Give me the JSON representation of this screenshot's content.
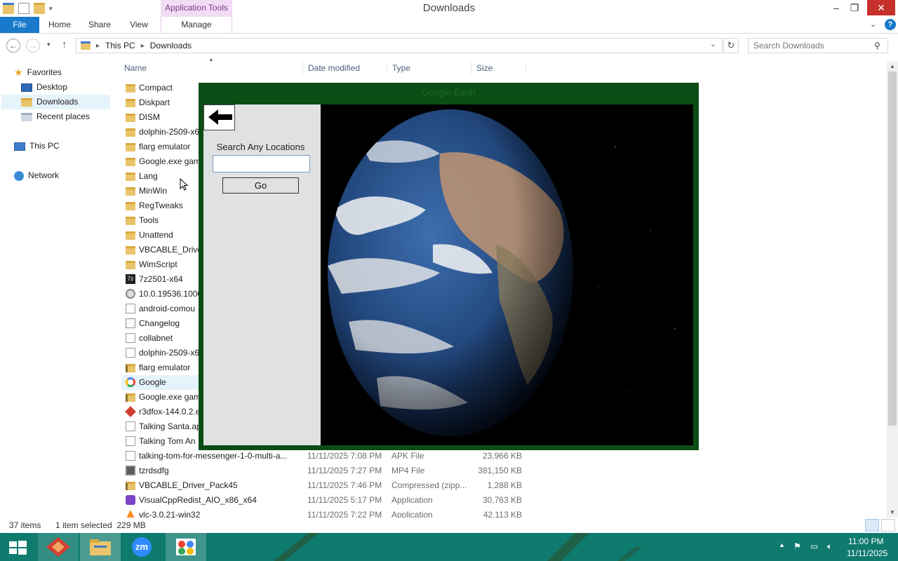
{
  "window": {
    "title": "Downloads",
    "context_tab": "Application Tools"
  },
  "ribbon": {
    "tabs": [
      "File",
      "Home",
      "Share",
      "View",
      "Manage"
    ]
  },
  "address": {
    "crumbs": [
      "This PC",
      "Downloads"
    ],
    "search_placeholder": "Search Downloads"
  },
  "nav": {
    "favorites": "Favorites",
    "desktop": "Desktop",
    "downloads": "Downloads",
    "recent": "Recent places",
    "this_pc": "This PC",
    "network": "Network"
  },
  "columns": [
    "Name",
    "Date modified",
    "Type",
    "Size"
  ],
  "files": [
    {
      "name": "Compact",
      "icon": "folder",
      "date": "",
      "type": "",
      "size": ""
    },
    {
      "name": "Diskpart",
      "icon": "folder",
      "date": "",
      "type": "",
      "size": ""
    },
    {
      "name": "DISM",
      "icon": "folder",
      "date": "",
      "type": "",
      "size": ""
    },
    {
      "name": "dolphin-2509-x6",
      "icon": "folder",
      "date": "",
      "type": "",
      "size": ""
    },
    {
      "name": "flarg emulator",
      "icon": "folder",
      "date": "",
      "type": "",
      "size": ""
    },
    {
      "name": "Google.exe gam",
      "icon": "folder",
      "date": "",
      "type": "",
      "size": ""
    },
    {
      "name": "Lang",
      "icon": "folder",
      "date": "",
      "type": "",
      "size": ""
    },
    {
      "name": "MinWin",
      "icon": "folder",
      "date": "",
      "type": "",
      "size": ""
    },
    {
      "name": "RegTweaks",
      "icon": "folder",
      "date": "",
      "type": "",
      "size": ""
    },
    {
      "name": "Tools",
      "icon": "folder",
      "date": "",
      "type": "",
      "size": ""
    },
    {
      "name": "Unattend",
      "icon": "folder",
      "date": "",
      "type": "",
      "size": ""
    },
    {
      "name": "VBCABLE_Driver",
      "icon": "folder",
      "date": "",
      "type": "",
      "size": ""
    },
    {
      "name": "WimScript",
      "icon": "folder",
      "date": "",
      "type": "",
      "size": ""
    },
    {
      "name": "7z2501-x64",
      "icon": "7z",
      "date": "",
      "type": "",
      "size": ""
    },
    {
      "name": "10.0.19536.1000.",
      "icon": "gear",
      "date": "",
      "type": "",
      "size": ""
    },
    {
      "name": "android-comou",
      "icon": "doc",
      "date": "",
      "type": "",
      "size": ""
    },
    {
      "name": "Changelog",
      "icon": "txt",
      "date": "",
      "type": "",
      "size": ""
    },
    {
      "name": "collabnet",
      "icon": "doc",
      "date": "",
      "type": "",
      "size": ""
    },
    {
      "name": "dolphin-2509-x6",
      "icon": "doc",
      "date": "",
      "type": "",
      "size": ""
    },
    {
      "name": "flarg emulator",
      "icon": "zip",
      "date": "",
      "type": "",
      "size": ""
    },
    {
      "name": "Google",
      "icon": "google",
      "date": "",
      "type": "",
      "size": ""
    },
    {
      "name": "Google.exe gam",
      "icon": "zip",
      "date": "",
      "type": "",
      "size": ""
    },
    {
      "name": "r3dfox-144.0.2.e",
      "icon": "fox",
      "date": "",
      "type": "",
      "size": ""
    },
    {
      "name": "Talking Santa.ap",
      "icon": "doc",
      "date": "",
      "type": "",
      "size": ""
    },
    {
      "name": "Talking Tom An",
      "icon": "doc",
      "date": "",
      "type": "",
      "size": ""
    },
    {
      "name": "talking-tom-for-messenger-1-0-multi-a...",
      "icon": "doc",
      "date": "11/11/2025 7:08 PM",
      "type": "APK File",
      "size": "23,966 KB"
    },
    {
      "name": "tzrdsdfg",
      "icon": "video",
      "date": "11/11/2025 7:27 PM",
      "type": "MP4 File",
      "size": "381,150 KB"
    },
    {
      "name": "VBCABLE_Driver_Pack45",
      "icon": "zip",
      "date": "11/11/2025 7:46 PM",
      "type": "Compressed (zipp...",
      "size": "1,288 KB"
    },
    {
      "name": "VisualCppRedist_AIO_x86_x64",
      "icon": "vs",
      "date": "11/11/2025 5:17 PM",
      "type": "Application",
      "size": "30,763 KB"
    },
    {
      "name": "vlc-3.0.21-win32",
      "icon": "cone",
      "date": "11/11/2025 7:22 PM",
      "type": "Application",
      "size": "42,113 KB"
    }
  ],
  "status": {
    "count": "37 items",
    "selected": "1 item selected  229 MB"
  },
  "earth_app": {
    "title": "Google Earth",
    "search_label": "Search Any Locations",
    "input_value": "",
    "go_label": "Go"
  },
  "taskbar": {
    "time": "11:00 PM",
    "date": "11/11/2025",
    "zoom_label": "zm"
  },
  "colors": {
    "accent": "#1979ca",
    "app_frame": "#0b4d15",
    "taskbar": "#0f7a6e",
    "context_tab": "#f1dcf4"
  }
}
